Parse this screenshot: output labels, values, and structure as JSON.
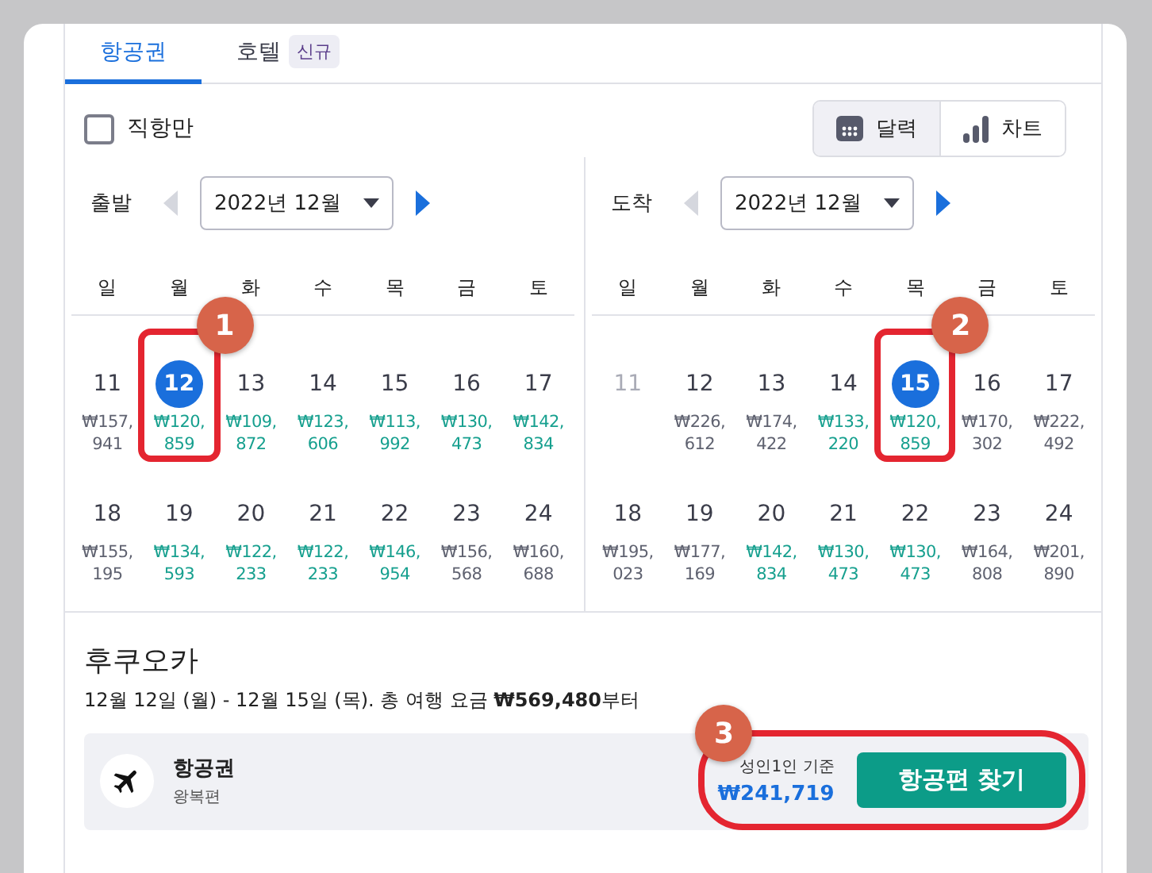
{
  "tabs": [
    {
      "label": "항공권",
      "selected": true
    },
    {
      "label": "호텔",
      "selected": false,
      "badge": "신규"
    }
  ],
  "direct_only": {
    "label": "직항만",
    "checked": false
  },
  "view_toggle": [
    {
      "label": "달력",
      "kind": "calendar",
      "selected": true
    },
    {
      "label": "차트",
      "kind": "chart",
      "selected": false
    }
  ],
  "calendars": [
    {
      "label": "출발",
      "month": "2022년 12월",
      "prev_enabled": false,
      "next_enabled": true,
      "weekdays": [
        "일",
        "월",
        "화",
        "수",
        "목",
        "금",
        "토"
      ],
      "weeks": [
        [
          {
            "day": "11",
            "price": "₩157,941",
            "cheap": false,
            "selected": false,
            "disabled": false
          },
          {
            "day": "12",
            "price": "₩120,859",
            "cheap": true,
            "selected": true,
            "disabled": false,
            "annotation": "1"
          },
          {
            "day": "13",
            "price": "₩109,872",
            "cheap": true,
            "selected": false,
            "disabled": false
          },
          {
            "day": "14",
            "price": "₩123,606",
            "cheap": true,
            "selected": false,
            "disabled": false
          },
          {
            "day": "15",
            "price": "₩113,992",
            "cheap": true,
            "selected": false,
            "disabled": false
          },
          {
            "day": "16",
            "price": "₩130,473",
            "cheap": true,
            "selected": false,
            "disabled": false
          },
          {
            "day": "17",
            "price": "₩142,834",
            "cheap": true,
            "selected": false,
            "disabled": false
          }
        ],
        [
          {
            "day": "18",
            "price": "₩155,195",
            "cheap": false,
            "selected": false,
            "disabled": false
          },
          {
            "day": "19",
            "price": "₩134,593",
            "cheap": true,
            "selected": false,
            "disabled": false
          },
          {
            "day": "20",
            "price": "₩122,233",
            "cheap": true,
            "selected": false,
            "disabled": false
          },
          {
            "day": "21",
            "price": "₩122,233",
            "cheap": true,
            "selected": false,
            "disabled": false
          },
          {
            "day": "22",
            "price": "₩146,954",
            "cheap": true,
            "selected": false,
            "disabled": false
          },
          {
            "day": "23",
            "price": "₩156,568",
            "cheap": false,
            "selected": false,
            "disabled": false
          },
          {
            "day": "24",
            "price": "₩160,688",
            "cheap": false,
            "selected": false,
            "disabled": false
          }
        ]
      ]
    },
    {
      "label": "도착",
      "month": "2022년 12월",
      "prev_enabled": false,
      "next_enabled": true,
      "weekdays": [
        "일",
        "월",
        "화",
        "수",
        "목",
        "금",
        "토"
      ],
      "weeks": [
        [
          {
            "day": "11",
            "selected": false,
            "disabled": true
          },
          {
            "day": "12",
            "price": "₩226,612",
            "cheap": false,
            "selected": false,
            "disabled": false
          },
          {
            "day": "13",
            "price": "₩174,422",
            "cheap": false,
            "selected": false,
            "disabled": false
          },
          {
            "day": "14",
            "price": "₩133,220",
            "cheap": true,
            "selected": false,
            "disabled": false
          },
          {
            "day": "15",
            "price": "₩120,859",
            "cheap": true,
            "selected": true,
            "disabled": false,
            "annotation": "2"
          },
          {
            "day": "16",
            "price": "₩170,302",
            "cheap": false,
            "selected": false,
            "disabled": false
          },
          {
            "day": "17",
            "price": "₩222,492",
            "cheap": false,
            "selected": false,
            "disabled": false
          }
        ],
        [
          {
            "day": "18",
            "price": "₩195,023",
            "cheap": false,
            "selected": false,
            "disabled": false
          },
          {
            "day": "19",
            "price": "₩177,169",
            "cheap": false,
            "selected": false,
            "disabled": false
          },
          {
            "day": "20",
            "price": "₩142,834",
            "cheap": true,
            "selected": false,
            "disabled": false
          },
          {
            "day": "21",
            "price": "₩130,473",
            "cheap": true,
            "selected": false,
            "disabled": false
          },
          {
            "day": "22",
            "price": "₩130,473",
            "cheap": true,
            "selected": false,
            "disabled": false
          },
          {
            "day": "23",
            "price": "₩164,808",
            "cheap": false,
            "selected": false,
            "disabled": false
          },
          {
            "day": "24",
            "price": "₩201,890",
            "cheap": false,
            "selected": false,
            "disabled": false
          }
        ]
      ]
    }
  ],
  "footer": {
    "city": "후쿠오카",
    "summary": "12월 12일 (월) - 12월 15일 (목). 총 여행 요금 **₩569,480**부터",
    "product": {
      "title": "항공권",
      "subtitle": "왕복편"
    },
    "price_note": "성인1인 기준",
    "price": "₩241,719",
    "button": "항공편 찾기",
    "annotation": "3"
  }
}
